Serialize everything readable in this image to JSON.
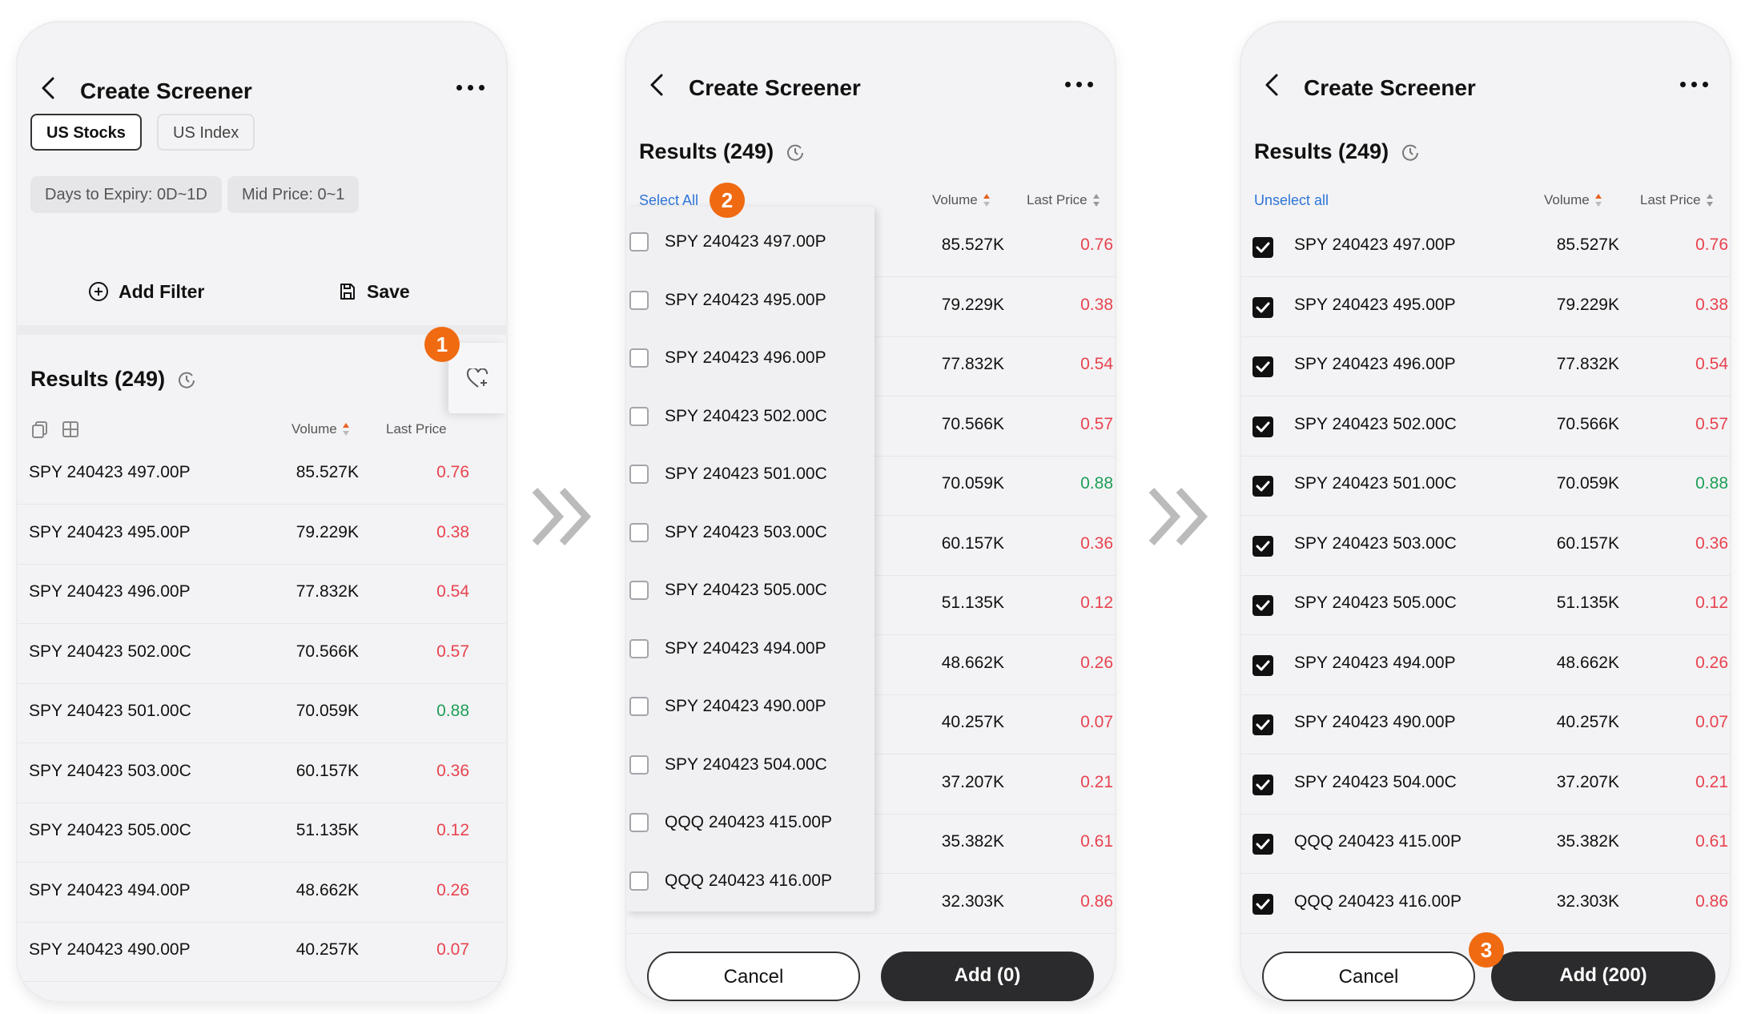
{
  "header": {
    "title": "Create Screener"
  },
  "markets": [
    {
      "label": "US Stocks",
      "active": true
    },
    {
      "label": "US Index",
      "active": false
    }
  ],
  "filters": [
    "Days to Expiry: 0D~1D",
    "Mid Price: 0~1"
  ],
  "actions": {
    "add_filter": "Add Filter",
    "save": "Save"
  },
  "results_label": "Results (249)",
  "columns": {
    "volume": "Volume",
    "last_price": "Last Price"
  },
  "select_all": "Select All",
  "unselect_all": "Unselect all",
  "rows": [
    {
      "name": "SPY 240423 497.00P",
      "volume": "85.527K",
      "price": "0.76",
      "trend": "down"
    },
    {
      "name": "SPY 240423 495.00P",
      "volume": "79.229K",
      "price": "0.38",
      "trend": "down"
    },
    {
      "name": "SPY 240423 496.00P",
      "volume": "77.832K",
      "price": "0.54",
      "trend": "down"
    },
    {
      "name": "SPY 240423 502.00C",
      "volume": "70.566K",
      "price": "0.57",
      "trend": "down"
    },
    {
      "name": "SPY 240423 501.00C",
      "volume": "70.059K",
      "price": "0.88",
      "trend": "up"
    },
    {
      "name": "SPY 240423 503.00C",
      "volume": "60.157K",
      "price": "0.36",
      "trend": "down"
    },
    {
      "name": "SPY 240423 505.00C",
      "volume": "51.135K",
      "price": "0.12",
      "trend": "down"
    },
    {
      "name": "SPY 240423 494.00P",
      "volume": "48.662K",
      "price": "0.26",
      "trend": "down"
    },
    {
      "name": "SPY 240423 490.00P",
      "volume": "40.257K",
      "price": "0.07",
      "trend": "down"
    },
    {
      "name": "SPY 240423 504.00C",
      "volume": "37.207K",
      "price": "0.21",
      "trend": "down"
    },
    {
      "name": "QQQ 240423 415.00P",
      "volume": "35.382K",
      "price": "0.61",
      "trend": "down"
    },
    {
      "name": "QQQ 240423 416.00P",
      "volume": "32.303K",
      "price": "0.86",
      "trend": "down"
    }
  ],
  "buttons": {
    "cancel": "Cancel",
    "add_zero": "Add (0)",
    "add_selected": "Add (200)"
  },
  "badges": {
    "one": "1",
    "two": "2",
    "three": "3"
  },
  "colors": {
    "up": "#1e9e56",
    "down": "#e8434f",
    "badge": "#f06a12",
    "link": "#2f74d6"
  }
}
